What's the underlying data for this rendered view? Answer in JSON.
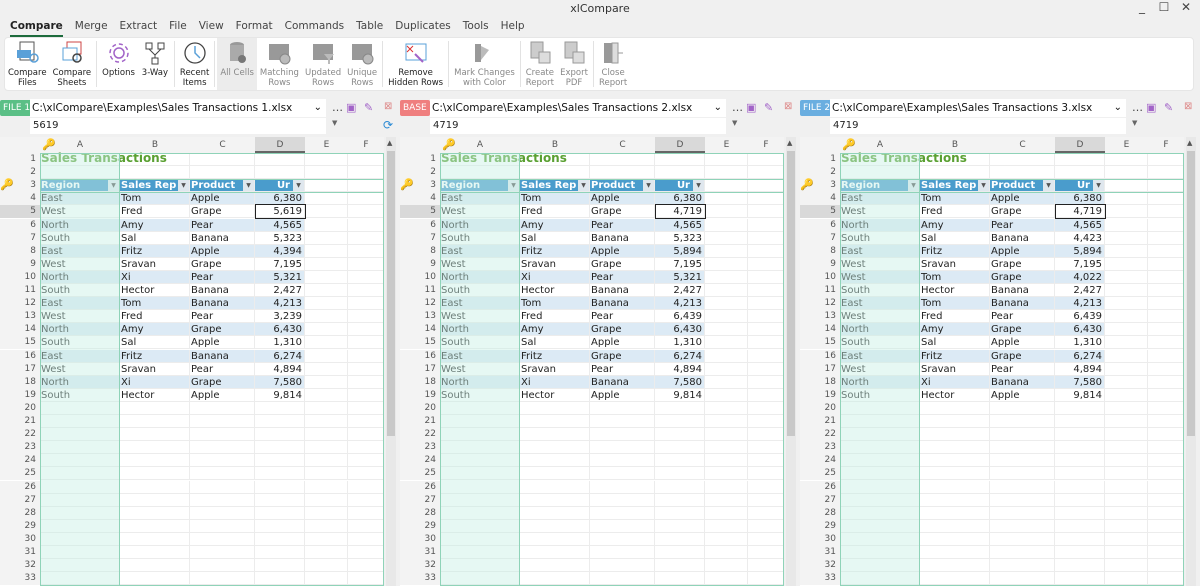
{
  "window": {
    "title": "xlCompare",
    "minimize": "_",
    "maximize": "☐",
    "close": "✕"
  },
  "menu": [
    "Compare",
    "Merge",
    "Extract",
    "File",
    "View",
    "Format",
    "Commands",
    "Table",
    "Duplicates",
    "Tools",
    "Help"
  ],
  "ribbon": [
    {
      "l1": "Compare",
      "l2": "Files",
      "icon": "compare-files-icon",
      "state": "normal"
    },
    {
      "l1": "Compare",
      "l2": "Sheets",
      "icon": "compare-sheets-icon",
      "state": "normal"
    },
    {
      "l1": "Options",
      "l2": "",
      "icon": "gear-icon",
      "state": "normal"
    },
    {
      "l1": "3-Way",
      "l2": "",
      "icon": "three-way-icon",
      "state": "normal"
    },
    {
      "l1": "Recent",
      "l2": "Items",
      "icon": "history-icon",
      "state": "normal"
    },
    {
      "l1": "All Cells",
      "l2": "",
      "icon": "all-cells-icon",
      "state": "selected"
    },
    {
      "l1": "Matching",
      "l2": "Rows",
      "icon": "matching-rows-icon",
      "state": "disabled"
    },
    {
      "l1": "Updated",
      "l2": "Rows",
      "icon": "updated-rows-icon",
      "state": "disabled"
    },
    {
      "l1": "Unique",
      "l2": "Rows",
      "icon": "unique-rows-icon",
      "state": "disabled"
    },
    {
      "l1": "Remove",
      "l2": "Hidden Rows",
      "icon": "remove-hidden-rows-icon",
      "state": "normal"
    },
    {
      "l1": "Mark Changes",
      "l2": "with Color",
      "icon": "color-palette-icon",
      "state": "disabled"
    },
    {
      "l1": "Create",
      "l2": "Report",
      "icon": "create-report-icon",
      "state": "disabled"
    },
    {
      "l1": "Export",
      "l2": "PDF",
      "icon": "export-pdf-icon",
      "state": "disabled"
    },
    {
      "l1": "Close",
      "l2": "Report",
      "icon": "close-report-icon",
      "state": "disabled"
    }
  ],
  "columns": [
    "A",
    "B",
    "C",
    "D",
    "E",
    "F"
  ],
  "sheet_title": "Sales Transactions",
  "table_headers": [
    "Region",
    "Sales Rep",
    "Product",
    "Ur"
  ],
  "row_numbers": [
    1,
    2,
    3,
    4,
    5,
    6,
    7,
    8,
    9,
    10,
    11,
    12,
    13,
    14,
    15,
    16,
    17,
    18,
    19,
    20,
    21,
    22,
    23,
    24,
    25,
    26,
    27,
    28,
    29,
    30,
    31,
    32,
    33
  ],
  "panels": [
    {
      "badge": "FILE 1",
      "badge_color": "#5bbf86",
      "path": "C:\\xlCompare\\Examples\\Sales Transactions 1.xlsx",
      "cell_value": "5619",
      "rows": [
        [
          "East",
          "Tom",
          "Apple",
          "6,380"
        ],
        [
          "West",
          "Fred",
          "Grape",
          "5,619"
        ],
        [
          "North",
          "Amy",
          "Pear",
          "4,565"
        ],
        [
          "South",
          "Sal",
          "Banana",
          "5,323"
        ],
        [
          "East",
          "Fritz",
          "Apple",
          "4,394"
        ],
        [
          "West",
          "Sravan",
          "Grape",
          "7,195"
        ],
        [
          "North",
          "Xi",
          "Pear",
          "5,321"
        ],
        [
          "South",
          "Hector",
          "Banana",
          "2,427"
        ],
        [
          "East",
          "Tom",
          "Banana",
          "4,213"
        ],
        [
          "West",
          "Fred",
          "Pear",
          "3,239"
        ],
        [
          "North",
          "Amy",
          "Grape",
          "6,430"
        ],
        [
          "South",
          "Sal",
          "Apple",
          "1,310"
        ],
        [
          "East",
          "Fritz",
          "Banana",
          "6,274"
        ],
        [
          "West",
          "Sravan",
          "Pear",
          "4,894"
        ],
        [
          "North",
          "Xi",
          "Grape",
          "7,580"
        ],
        [
          "South",
          "Hector",
          "Apple",
          "9,814"
        ]
      ]
    },
    {
      "badge": "BASE",
      "badge_color": "#ef7f7f",
      "path": "C:\\xlCompare\\Examples\\Sales Transactions 2.xlsx",
      "cell_value": "4719",
      "rows": [
        [
          "East",
          "Tom",
          "Apple",
          "6,380"
        ],
        [
          "West",
          "Fred",
          "Grape",
          "4,719"
        ],
        [
          "North",
          "Amy",
          "Pear",
          "4,565"
        ],
        [
          "South",
          "Sal",
          "Banana",
          "5,323"
        ],
        [
          "East",
          "Fritz",
          "Apple",
          "5,894"
        ],
        [
          "West",
          "Sravan",
          "Grape",
          "7,195"
        ],
        [
          "North",
          "Xi",
          "Pear",
          "5,321"
        ],
        [
          "South",
          "Hector",
          "Banana",
          "2,427"
        ],
        [
          "East",
          "Tom",
          "Banana",
          "4,213"
        ],
        [
          "West",
          "Fred",
          "Pear",
          "6,439"
        ],
        [
          "North",
          "Amy",
          "Grape",
          "6,430"
        ],
        [
          "South",
          "Sal",
          "Apple",
          "1,310"
        ],
        [
          "East",
          "Fritz",
          "Grape",
          "6,274"
        ],
        [
          "West",
          "Sravan",
          "Pear",
          "4,894"
        ],
        [
          "North",
          "Xi",
          "Banana",
          "7,580"
        ],
        [
          "South",
          "Hector",
          "Apple",
          "9,814"
        ]
      ]
    },
    {
      "badge": "FILE 2",
      "badge_color": "#6aaee0",
      "path": "C:\\xlCompare\\Examples\\Sales Transactions 3.xlsx",
      "cell_value": "4719",
      "rows": [
        [
          "East",
          "Tom",
          "Apple",
          "6,380"
        ],
        [
          "West",
          "Fred",
          "Grape",
          "4,719"
        ],
        [
          "North",
          "Amy",
          "Pear",
          "4,565"
        ],
        [
          "South",
          "Sal",
          "Banana",
          "4,423"
        ],
        [
          "East",
          "Fritz",
          "Apple",
          "5,894"
        ],
        [
          "West",
          "Sravan",
          "Grape",
          "7,195"
        ],
        [
          "West",
          "Tom",
          "Grape",
          "4,022"
        ],
        [
          "South",
          "Hector",
          "Banana",
          "2,427"
        ],
        [
          "East",
          "Tom",
          "Banana",
          "4,213"
        ],
        [
          "West",
          "Fred",
          "Pear",
          "6,439"
        ],
        [
          "North",
          "Amy",
          "Grape",
          "6,430"
        ],
        [
          "South",
          "Sal",
          "Apple",
          "1,310"
        ],
        [
          "East",
          "Fritz",
          "Grape",
          "6,274"
        ],
        [
          "West",
          "Sravan",
          "Pear",
          "4,894"
        ],
        [
          "North",
          "Xi",
          "Banana",
          "7,580"
        ],
        [
          "South",
          "Hector",
          "Apple",
          "9,814"
        ]
      ]
    }
  ],
  "colors": {
    "header_blue": "#4a9ccc",
    "title_green": "#5aa032",
    "key_border": "#8fd3b8",
    "key_icon": "#e0a030"
  }
}
